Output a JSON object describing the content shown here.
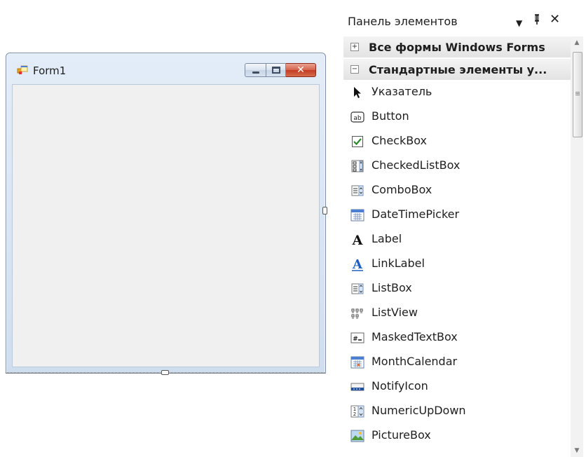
{
  "form": {
    "title": "Form1",
    "caption_buttons": {
      "minimize": "minimize-icon",
      "maximize": "maximize-icon",
      "close": "close-icon"
    }
  },
  "toolbox": {
    "title": "Панель элементов",
    "header_buttons": {
      "dropdown": "dropdown-icon",
      "pin": "pin-icon",
      "close": "close-icon"
    },
    "categories": [
      {
        "label": "Все формы Windows Forms",
        "state": "collapsed"
      },
      {
        "label": "Стандартные элементы у...",
        "state": "expanded"
      }
    ],
    "items": [
      {
        "label": "Указатель",
        "icon": "pointer-icon"
      },
      {
        "label": "Button",
        "icon": "button-icon"
      },
      {
        "label": "CheckBox",
        "icon": "checkbox-icon"
      },
      {
        "label": "CheckedListBox",
        "icon": "checkedlistbox-icon"
      },
      {
        "label": "ComboBox",
        "icon": "combobox-icon"
      },
      {
        "label": "DateTimePicker",
        "icon": "datetimepicker-icon"
      },
      {
        "label": "Label",
        "icon": "label-icon"
      },
      {
        "label": "LinkLabel",
        "icon": "linklabel-icon"
      },
      {
        "label": "ListBox",
        "icon": "listbox-icon"
      },
      {
        "label": "ListView",
        "icon": "listview-icon"
      },
      {
        "label": "MaskedTextBox",
        "icon": "maskedtextbox-icon"
      },
      {
        "label": "MonthCalendar",
        "icon": "monthcalendar-icon"
      },
      {
        "label": "NotifyIcon",
        "icon": "notifyicon-icon"
      },
      {
        "label": "NumericUpDown",
        "icon": "numericupdown-icon"
      },
      {
        "label": "PictureBox",
        "icon": "picturebox-icon"
      }
    ]
  },
  "colors": {
    "category_bg": "#e6e6e6",
    "checkbox_green": "#2a8a2a",
    "link_blue": "#1f5fbf"
  }
}
